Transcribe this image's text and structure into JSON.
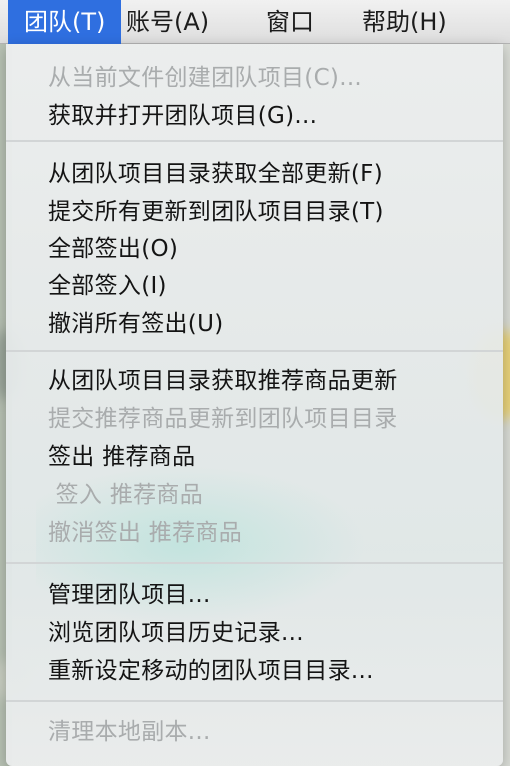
{
  "menubar": {
    "items": [
      {
        "label": "团队(T)",
        "active": true
      },
      {
        "label": "账号(A)",
        "active": false
      },
      {
        "label": "窗口",
        "active": false
      },
      {
        "label": "帮助(H)",
        "active": false
      }
    ]
  },
  "menu": {
    "groups": [
      [
        {
          "label": "从当前文件创建团队项目(C)...",
          "enabled": false
        },
        {
          "label": "获取并打开团队项目(G)...",
          "enabled": true
        }
      ],
      [
        {
          "label": "从团队项目目录获取全部更新(F)",
          "enabled": true
        },
        {
          "label": "提交所有更新到团队项目目录(T)",
          "enabled": true
        },
        {
          "label": "全部签出(O)",
          "enabled": true
        },
        {
          "label": "全部签入(I)",
          "enabled": true
        },
        {
          "label": "撤消所有签出(U)",
          "enabled": true
        }
      ],
      [
        {
          "label": "从团队项目目录获取推荐商品更新",
          "enabled": true
        },
        {
          "label": "提交推荐商品更新到团队项目目录",
          "enabled": false
        },
        {
          "label": "签出 推荐商品",
          "enabled": true
        },
        {
          "label": " 签入 推荐商品",
          "enabled": false
        },
        {
          "label": "撤消签出 推荐商品",
          "enabled": false
        }
      ],
      [
        {
          "label": "管理团队项目...",
          "enabled": true
        },
        {
          "label": "浏览团队项目历史记录...",
          "enabled": true
        },
        {
          "label": "重新设定移动的团队项目目录...",
          "enabled": true
        }
      ],
      [
        {
          "label": "清理本地副本...",
          "enabled": false
        }
      ]
    ]
  },
  "colors": {
    "accent": "#2f6fe0",
    "disabled_text": "#a9acad",
    "text": "#141414"
  }
}
